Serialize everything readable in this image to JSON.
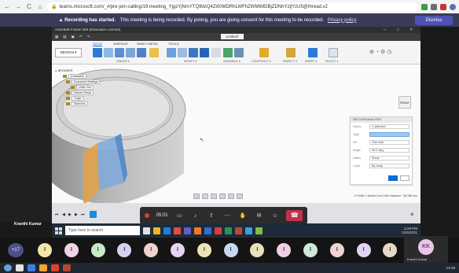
{
  "browser": {
    "url": "teams.microsoft.com/_#/pre-join-calling/19:meeting_YjgzYjNmYTQtMzQ4Zi00MDRhLWFhZWMtMDBjZDNhYzljYzU5@thread.v2",
    "nav_back": "←",
    "nav_forward": "→",
    "reload": "C",
    "home": "⌂"
  },
  "banner": {
    "title": "Recording has started.",
    "message": "This meeting is being recorded. By joining, you are giving consent for this meeting to be recorded.",
    "link": "Privacy policy",
    "dismiss": "Dismiss"
  },
  "fusion": {
    "window_title": "Autodesk Fusion 360 (Education License)",
    "document_tab": "Untitled*",
    "workspace": "DESIGN ▾",
    "ribbon_tabs": [
      "SOLID",
      "SURFACE",
      "SHEET METAL",
      "TOOLS"
    ],
    "ribbon_groups": [
      "CREATE ▾",
      "MODIFY ▾",
      "ASSEMBLE ▾",
      "CONSTRUCT ▾",
      "INSPECT ▾",
      "INSERT ▾",
      "SELECT ▾"
    ],
    "browser_title": "BROWSER",
    "browser_items": [
      "(Unsaved)",
      "Document Settings",
      "Named Views",
      "Origin",
      "Sketches"
    ],
    "browser_item_units": "Units: mm",
    "viewcube": "FRONT",
    "section_dialog": {
      "title": "SECTION ANALYSIS",
      "rows": [
        {
          "key": "Faces",
          "value": "1 selected"
        },
        {
          "key": "Type",
          "value": ""
        },
        {
          "key": "Dir",
          "value": "One side"
        },
        {
          "key": "Angle",
          "value": "90.0 deg"
        },
        {
          "key": "Hatch",
          "value": "Show"
        },
        {
          "key": "Color",
          "value": "By body"
        }
      ]
    },
    "status_text": "1 Profile 1 Sketch Line | Min Distance : 38.786 mm"
  },
  "meeting_controls": {
    "timer": "05:01",
    "icons": [
      "camera-icon",
      "mic-icon",
      "share-icon",
      "more-icon",
      "hand-icon",
      "chat-icon",
      "people-icon",
      "hangup-icon"
    ]
  },
  "presenter_name": "Kranthi Kumar",
  "win_taskbar": {
    "search_placeholder": "Type here to search",
    "time": "3:29 PM",
    "date": "12/6/2021"
  },
  "participants": {
    "overflow": "+17",
    "initial": "I",
    "colors": [
      "#f3e7a8",
      "#f0d4e8",
      "#c8e8c8",
      "#d7d0f0",
      "#f3d0d0",
      "#e8d4f0",
      "#f0e2b8",
      "#c8d8f0",
      "#e8e0b8",
      "#f0d0e8",
      "#d0e8d8",
      "#f0d4d4",
      "#e0d4f0",
      "#e8d8c8",
      "#f0e4b0"
    ],
    "self_initials": "KK",
    "self_name": "Kranthi Kumar"
  },
  "os_taskbar": {
    "time": "14:29"
  }
}
